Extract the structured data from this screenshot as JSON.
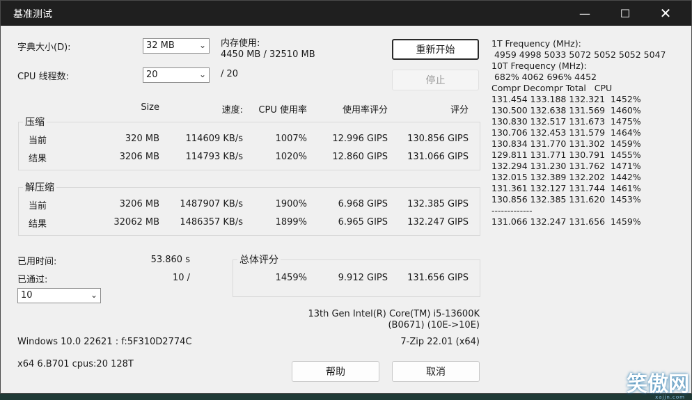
{
  "window": {
    "title": "基准测试"
  },
  "settings": {
    "dict_label": "字典大小(D):",
    "dict_value": "32 MB",
    "threads_label": "CPU 线程数:",
    "threads_value": "20",
    "threads_total": "/ 20",
    "mem_label": "内存使用:",
    "mem_value": "4450 MB / 32510 MB"
  },
  "buttons": {
    "restart": "重新开始",
    "stop": "停止",
    "help": "帮助",
    "cancel": "取消"
  },
  "headers": [
    "Size",
    "速度:",
    "CPU 使用率",
    "使用率评分",
    "评分"
  ],
  "compress": {
    "title": "压缩",
    "rows": [
      {
        "label": "当前",
        "size": "320 MB",
        "speed": "114609 KB/s",
        "cpu": "1007%",
        "rating_usage": "12.996 GIPS",
        "rating": "130.856 GIPS"
      },
      {
        "label": "结果",
        "size": "3206 MB",
        "speed": "114793 KB/s",
        "cpu": "1020%",
        "rating_usage": "12.860 GIPS",
        "rating": "131.066 GIPS"
      }
    ]
  },
  "decompress": {
    "title": "解压缩",
    "rows": [
      {
        "label": "当前",
        "size": "3206 MB",
        "speed": "1487907 KB/s",
        "cpu": "1900%",
        "rating_usage": "6.968 GIPS",
        "rating": "132.385 GIPS"
      },
      {
        "label": "结果",
        "size": "32062 MB",
        "speed": "1486357 KB/s",
        "cpu": "1899%",
        "rating_usage": "6.965 GIPS",
        "rating": "132.247 GIPS"
      }
    ]
  },
  "status": {
    "elapsed_label": "已用时间:",
    "elapsed_value": "53.860 s",
    "passes_label": "已通过:",
    "passes_value": "10 /",
    "passes_select": "10"
  },
  "total": {
    "title": "总体评分",
    "cpu": "1459%",
    "rating_usage": "9.912 GIPS",
    "rating": "131.656 GIPS"
  },
  "system": {
    "cpu_line1": "13th Gen Intel(R) Core(TM) i5-13600K",
    "cpu_line2": "(B0671) (10E->10E)",
    "os": "Windows 10.0 22621 : f:5F310D2774C",
    "version": "7-Zip 22.01 (x64)",
    "arch": "x64 6.B701 cpus:20 128T"
  },
  "right_panel": {
    "lines": [
      "1T Frequency (MHz):",
      " 4959 4998 5033 5072 5052 5052 5047",
      "10T Frequency (MHz):",
      " 682% 4062 696% 4452",
      "Compr Decompr Total   CPU",
      "131.454 133.188 132.321  1452%",
      "130.500 132.638 131.569  1460%",
      "130.830 132.517 131.673  1475%",
      "130.706 132.453 131.579  1464%",
      "130.834 131.770 131.302  1459%",
      "129.811 131.771 130.791  1455%",
      "132.294 131.230 131.762  1471%",
      "132.015 132.389 132.202  1442%",
      "131.361 132.127 131.744  1461%",
      "130.856 132.385 131.620  1453%",
      "-------------",
      "131.066 132.247 131.656  1459%"
    ]
  },
  "watermark": {
    "text": "笑傲网",
    "sub": "xajjn.com"
  }
}
